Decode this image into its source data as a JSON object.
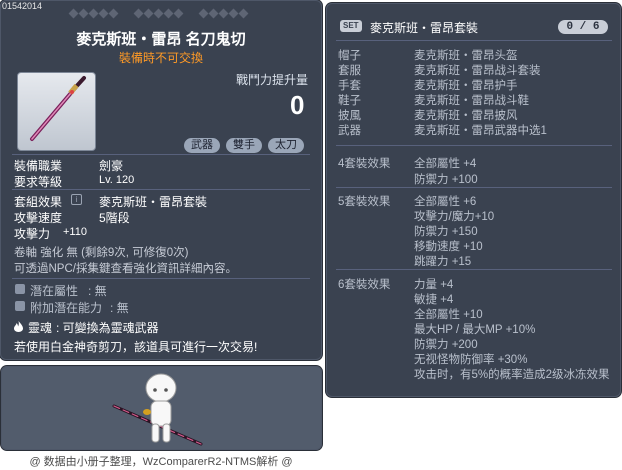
{
  "item": {
    "code": "01542014",
    "name": "麥克斯班・雷昂 名刀鬼切",
    "trade_note": "裝備時不可交換",
    "atk_increase_label": "戰鬥力提升量",
    "atk_increase_value": "0",
    "tags": [
      "武器",
      "雙手",
      "太刀"
    ],
    "job_label": "裝備職業",
    "job_value": "劍豪",
    "level_label": "要求等級",
    "level_value": "Lv. 120",
    "set_label": "套組效果",
    "set_value": "麥克斯班・雷昂套裝",
    "speed_label": "攻擊速度",
    "speed_value": "5階段",
    "attack_label": "攻擊力",
    "attack_value": "+110",
    "enhance_line1": "卷軸 強化 無 (剩餘9次, 可修復0次)",
    "enhance_line2": "可透過NPC/採集鍵查看強化資訊詳細內容。",
    "potential_label": "潛在屬性",
    "potential_value": ": 無",
    "add_potential_label": "附加潛在能力",
    "add_potential_value": ": 無",
    "soul_label": "靈魂",
    "soul_value": ": 可變換為靈魂武器",
    "scissors_note": "若使用白金神奇剪刀，該道具可進行一次交易!"
  },
  "footer": "@ 数据由小册子整理，WzComparerR2-NTMS解析 @",
  "set": {
    "badge": "SET",
    "title": "麥克斯班・雷昂套裝",
    "count": "0 / 6",
    "pieces": [
      {
        "slot": "帽子",
        "name": "麦克斯班・雷昂头盔"
      },
      {
        "slot": "套服",
        "name": "麦克斯班・雷昂战斗套装"
      },
      {
        "slot": "手套",
        "name": "麦克斯班・雷昂护手"
      },
      {
        "slot": "鞋子",
        "name": "麦克斯班・雷昂战斗鞋"
      },
      {
        "slot": "披風",
        "name": "麦克斯班・雷昂披风"
      },
      {
        "slot": "武器",
        "name": "麦克斯班・雷昂武器中选1"
      }
    ],
    "effect4_label": "4套裝效果",
    "effect4": [
      "全部屬性  +4",
      "防禦力  +100"
    ],
    "effect5_label": "5套裝效果",
    "effect5": [
      "全部屬性  +6",
      "攻擊力/魔力+10",
      "防禦力  +150",
      "移動速度  +10",
      "跳躍力  +15"
    ],
    "effect6_label": "6套裝效果",
    "effect6": [
      "力量  +4",
      "敏捷  +4",
      "全部屬性  +10",
      "最大HP / 最大MP  +10%",
      "防禦力  +200",
      "无视怪物防御率  +30%",
      "攻击时，有5%的概率造成2级冰冻效果"
    ]
  }
}
